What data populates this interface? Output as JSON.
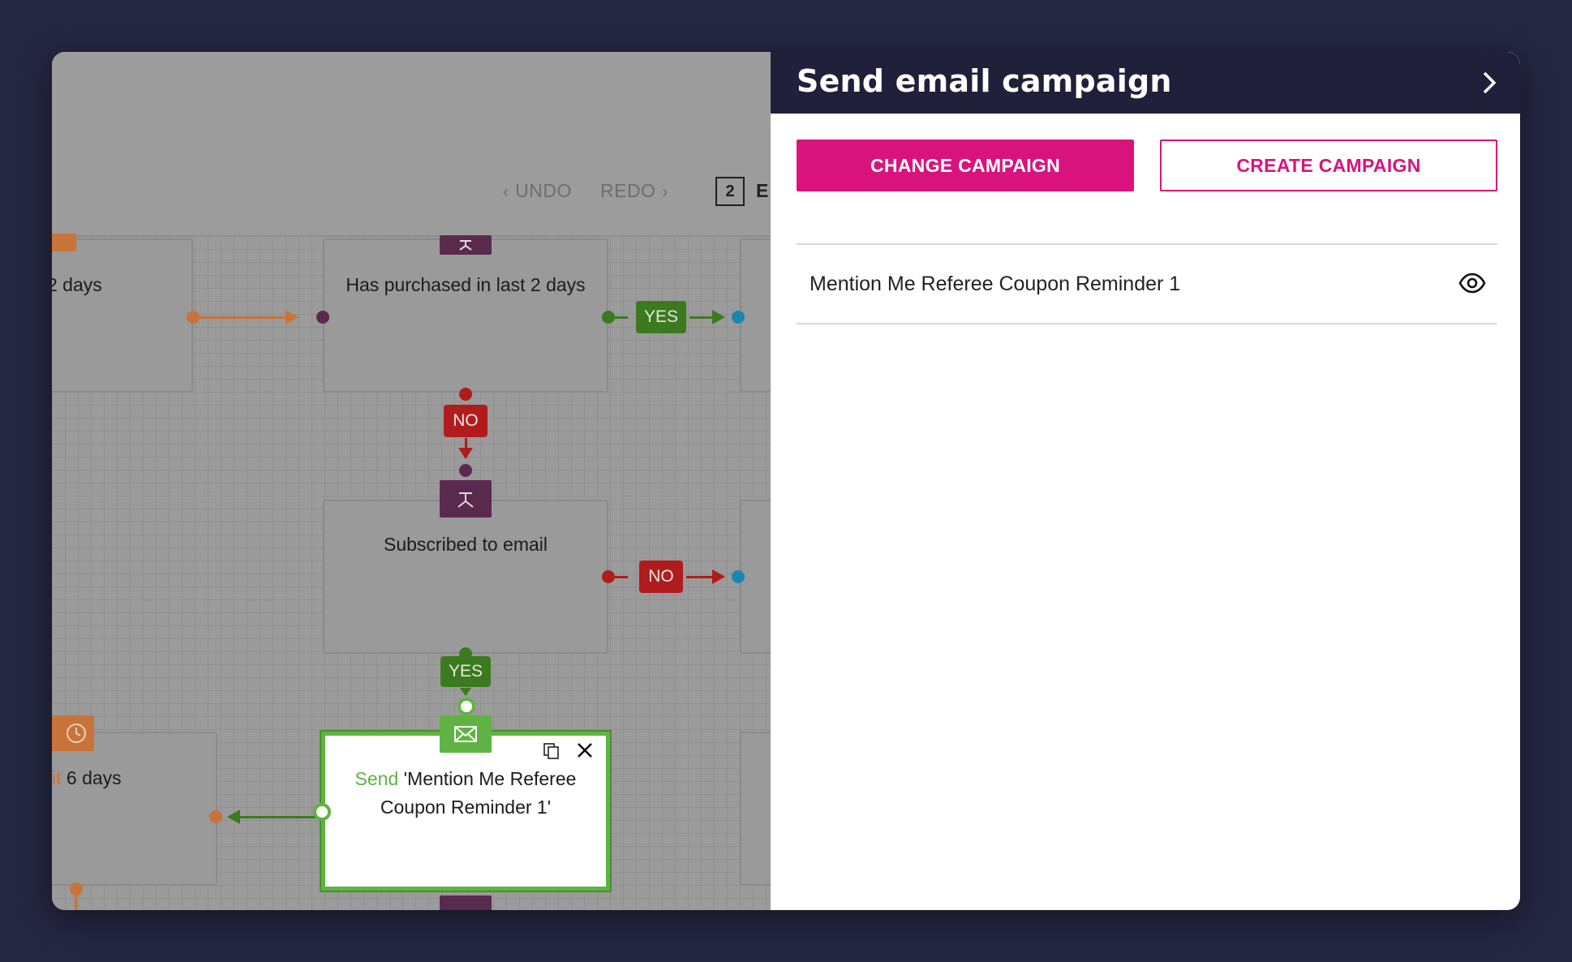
{
  "canvas": {
    "toolbar": {
      "undo_label": "UNDO",
      "redo_label": "REDO",
      "badge_count": "2",
      "badge_text": "E"
    },
    "nodes": {
      "left_top_text": "2 days",
      "purchased_text": "Has purchased in last 2 days",
      "subscribed_text": "Subscribed to email",
      "left_wait_prefix": "it",
      "left_wait_text": " 6 days",
      "send_prefix": "Send",
      "send_text": " 'Mention Me Referee Coupon Reminder 1'"
    },
    "labels": {
      "yes": "YES",
      "no": "NO"
    }
  },
  "panel": {
    "title": "Send email campaign",
    "change_button": "CHANGE CAMPAIGN",
    "create_button": "CREATE CAMPAIGN",
    "campaign_name": "Mention Me Referee Coupon Reminder 1"
  },
  "colors": {
    "accent": "#d9137e",
    "header": "#21203a",
    "yes_green": "#3b7a1e",
    "no_red": "#b01c1c",
    "wait_orange": "#c8733a",
    "condition_purple": "#5a2a4e",
    "selected_green": "#5fb342",
    "connector_blue": "#1b86b0"
  },
  "icons": [
    "chevron-left-icon",
    "chevron-right-icon",
    "clock-icon",
    "split-icon",
    "envelope-icon",
    "duplicate-icon",
    "close-icon",
    "eye-icon",
    "panel-collapse-icon"
  ]
}
